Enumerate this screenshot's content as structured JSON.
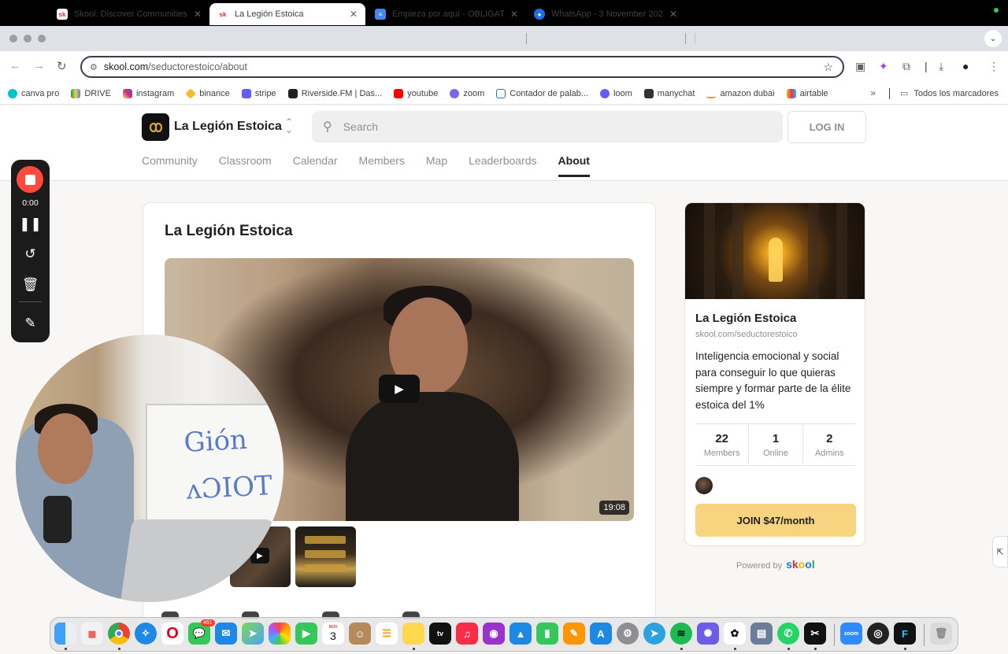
{
  "browser": {
    "tabs": [
      {
        "title": "Skool: Discover Communities",
        "favicon": "sk",
        "color": "#d93025"
      },
      {
        "title": "La Legión Estoica",
        "favicon": "sk",
        "color": "#d93025"
      },
      {
        "title": "Empieza por aquí - OBLIGATORIO",
        "favicon": "doc",
        "color": "#4285f4"
      },
      {
        "title": "WhatsApp - 3 November 2024",
        "favicon": "wa",
        "color": "#1a73e8"
      }
    ],
    "url_host": "skool.com",
    "url_path": "/seductorestoico/about",
    "bookmarks": [
      "canva pro",
      "DRIVE",
      "instagram",
      "binance",
      "stripe",
      "Riverside.FM | Das...",
      "youtube",
      "zoom",
      "Contador de palab...",
      "loom",
      "manychat",
      "amazon dubai",
      "airtable"
    ],
    "bookmarks_folder": "Todos los marcadores"
  },
  "header": {
    "group_name": "La Legión Estoica",
    "search_placeholder": "Search",
    "login_label": "LOG IN",
    "nav": [
      "Community",
      "Classroom",
      "Calendar",
      "Members",
      "Map",
      "Leaderboards",
      "About"
    ],
    "active_nav": "About"
  },
  "main": {
    "title": "La Legión Estoica",
    "video_duration": "19:08"
  },
  "sidebar": {
    "name": "La Legión Estoica",
    "url": "skool.com/seductorestoico",
    "description": "Inteligencia emocional y social para conseguir lo que quieras siempre y formar parte de la élite estoica del 1%",
    "stats": [
      {
        "value": "22",
        "label": "Members"
      },
      {
        "value": "1",
        "label": "Online"
      },
      {
        "value": "2",
        "label": "Admins"
      }
    ],
    "join_label": "JOIN $47/month",
    "powered_by": "Powered by",
    "brand": "skool",
    "brand_colors": [
      "#1a73e8",
      "#d93025",
      "#f4b400",
      "#1a73e8",
      "#34a853"
    ]
  },
  "recorder": {
    "time": "0:00"
  },
  "webcam": {
    "board_text_1": "Gión",
    "board_text_2": "ʌƆIOT"
  },
  "dock": {
    "calendar_month": "NOV",
    "calendar_day": "3",
    "messages_badge": "461"
  },
  "colors": {
    "accent": "#f8d481",
    "record": "#ff4a3d"
  }
}
